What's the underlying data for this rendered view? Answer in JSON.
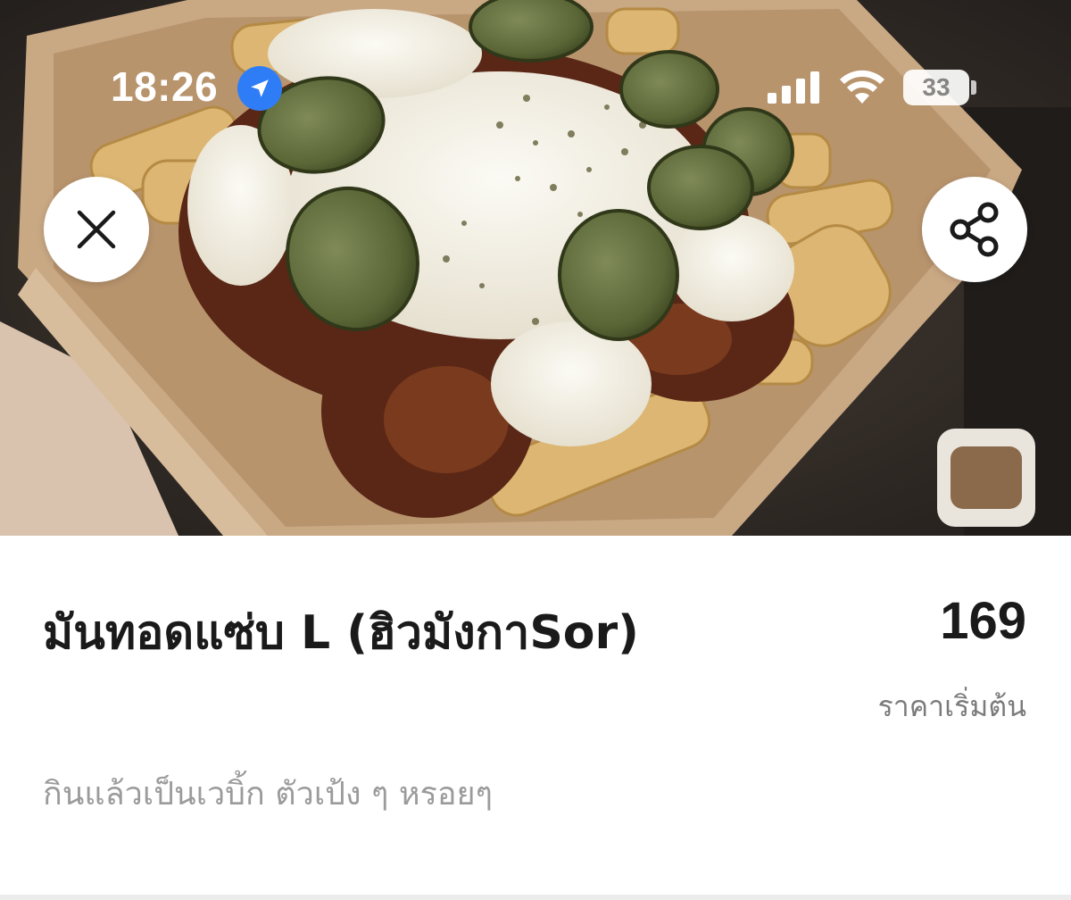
{
  "status_bar": {
    "time": "18:26",
    "battery_level": "33",
    "icons": [
      "location-arrow-icon",
      "cellular-signal-icon",
      "wifi-icon",
      "battery-icon"
    ]
  },
  "hero": {
    "image": "photo of loaded fries topped with chili meat sauce, melted cheese, herbs and pickle slices in a cardboard tray"
  },
  "buttons": {
    "close_icon": "close-icon",
    "share_icon": "share-icon"
  },
  "item": {
    "name": "มันทอดแซ่บ L (ฮิวมังกาSor)",
    "price": "169",
    "price_caption": "ราคาเริ่มต้น",
    "description": "กินแล้วเป็นเวบิ้ก ตัวเป้ง ๆ หรอยๆ"
  },
  "colors": {
    "location_badge": "#2f7df6",
    "text_primary": "#1a1a1a",
    "text_secondary": "#7b7b7b",
    "text_muted": "#9b9b9b"
  }
}
